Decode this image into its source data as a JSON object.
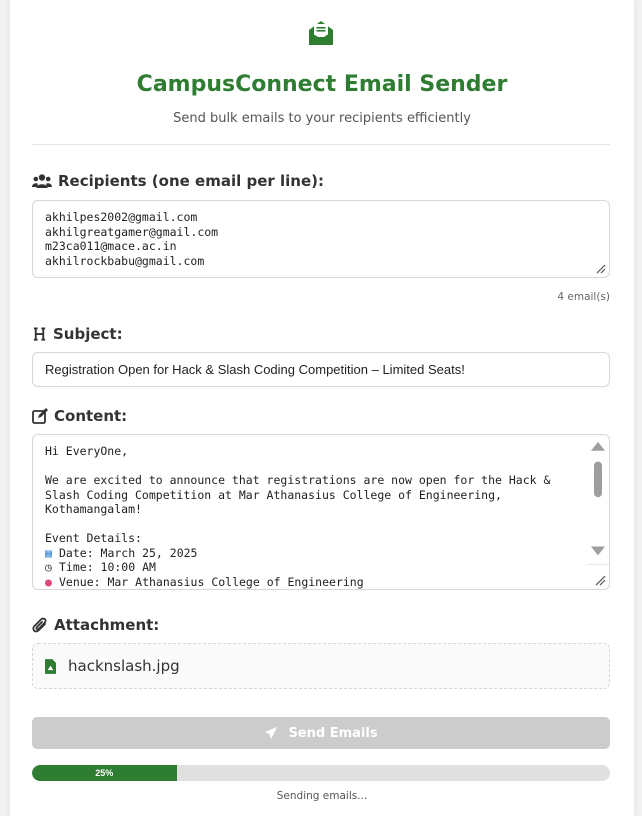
{
  "header": {
    "title": "CampusConnect Email Sender",
    "subtitle": "Send bulk emails to your recipients efficiently",
    "logo_icon": "envelope-open-icon",
    "accent_color": "#2e7d32"
  },
  "recipients": {
    "label": "Recipients (one email per line):",
    "icon": "users-icon",
    "emails": [
      "akhilpes2002@gmail.com",
      "akhilgreatgamer@gmail.com",
      "m23ca011@mace.ac.in",
      "akhilrockbabu@gmail.com"
    ],
    "count_text": "4 email(s)"
  },
  "subject": {
    "label": "Subject:",
    "icon": "heading-icon",
    "value": "Registration Open for Hack & Slash Coding Competition – Limited Seats!"
  },
  "content": {
    "label": "Content:",
    "icon": "edit-icon",
    "lines": [
      "Hi EveryOne,",
      "",
      "We are excited to announce that registrations are now open for the Hack &",
      "Slash Coding Competition at Mar Athanasius College of Engineering,",
      "Kothamangalam!",
      "",
      "Event Details:",
      "Date: March 25, 2025",
      "Time: 10:00 AM",
      "Venue: Mar Athanasius College of Engineering"
    ]
  },
  "attachment": {
    "label": "Attachment:",
    "icon": "paperclip-icon",
    "file_icon": "file-image-icon",
    "file_name": "hacknslash.jpg"
  },
  "send": {
    "label": "Send Emails",
    "icon": "paper-plane-icon"
  },
  "progress": {
    "percent": 25,
    "label": "25%",
    "status": "Sending emails..."
  }
}
